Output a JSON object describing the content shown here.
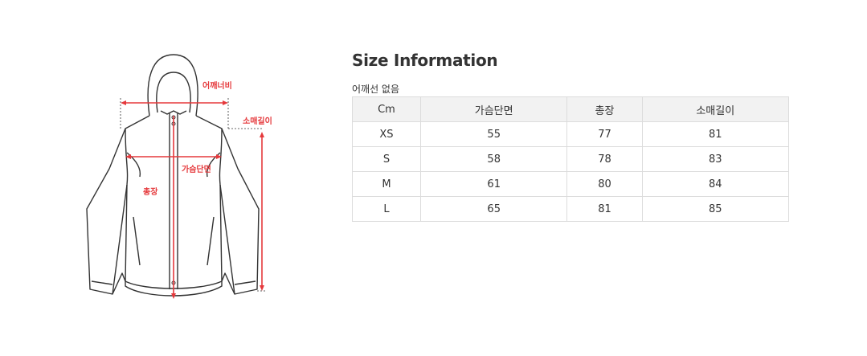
{
  "diagram": {
    "labels": {
      "shoulder": "어깨너비",
      "sleeve": "소매길이",
      "chest": "가슴단면",
      "length": "총장"
    },
    "colors": {
      "accent": "#e5393c",
      "outline": "#333333"
    }
  },
  "info": {
    "title": "Size Information",
    "note": "어깨선 없음"
  },
  "size_table": {
    "headers": [
      "Cm",
      "가슴단면",
      "총장",
      "소매길이"
    ],
    "rows": [
      [
        "XS",
        "55",
        "77",
        "81"
      ],
      [
        "S",
        "58",
        "78",
        "83"
      ],
      [
        "M",
        "61",
        "80",
        "84"
      ],
      [
        "L",
        "65",
        "81",
        "85"
      ]
    ]
  }
}
